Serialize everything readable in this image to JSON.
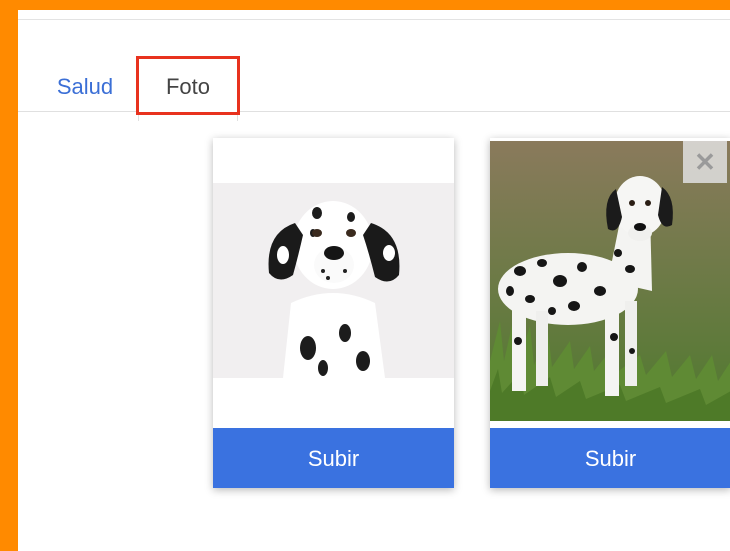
{
  "tabs": [
    {
      "label": "Salud",
      "active": false
    },
    {
      "label": "Foto",
      "active": true
    }
  ],
  "cards": [
    {
      "button_label": "Subir",
      "image": "dalmatian-headshot"
    },
    {
      "button_label": "Subir",
      "image": "dalmatian-standing-grass",
      "close_icon": "close-icon"
    }
  ],
  "colors": {
    "outer_background": "#ff8a00",
    "tab_link": "#3b6fd6",
    "highlight_border": "#e8321e",
    "button": "#3a72e0"
  }
}
